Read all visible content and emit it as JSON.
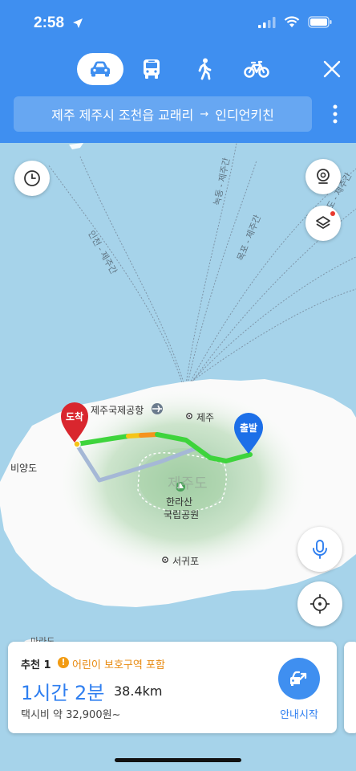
{
  "status_bar": {
    "time": "2:58"
  },
  "modes": [
    {
      "name": "car",
      "active": true
    },
    {
      "name": "bus",
      "active": false
    },
    {
      "name": "walk",
      "active": false
    },
    {
      "name": "bike",
      "active": false
    }
  ],
  "route": {
    "from": "제주 제주시 조천읍 교래리",
    "arrow": "→",
    "to": "인디언키친"
  },
  "map": {
    "labels": {
      "airport": "제주국제공항",
      "jeju_city": "제주",
      "biyangdo": "비양도",
      "island": "제주도",
      "hallasan_line1": "한라산",
      "hallasan_line2": "국립공원",
      "seogwipo": "서귀포",
      "marado": "마라도",
      "route_line_a": "인천 - 제주간",
      "route_line_b": "녹동 - 제주간",
      "route_line_c": "목포 - 제주간",
      "route_line_d": "진도 - 제주간"
    },
    "markers": {
      "destination": "도착",
      "origin": "출발"
    },
    "colors": {
      "traffic_green": "#3ed43c",
      "traffic_yellow": "#f5c518",
      "traffic_orange": "#f5931e",
      "alt_route": "#a5b8d6",
      "dest_marker": "#d9262e",
      "origin_marker": "#1c6fe8"
    }
  },
  "card": {
    "rank": "추천 1",
    "warning": "어린이 보호구역 포함",
    "duration": "1시간 2분",
    "distance": "38.4km",
    "taxi": "택시비 약 32,900원~",
    "start_label": "안내시작"
  }
}
